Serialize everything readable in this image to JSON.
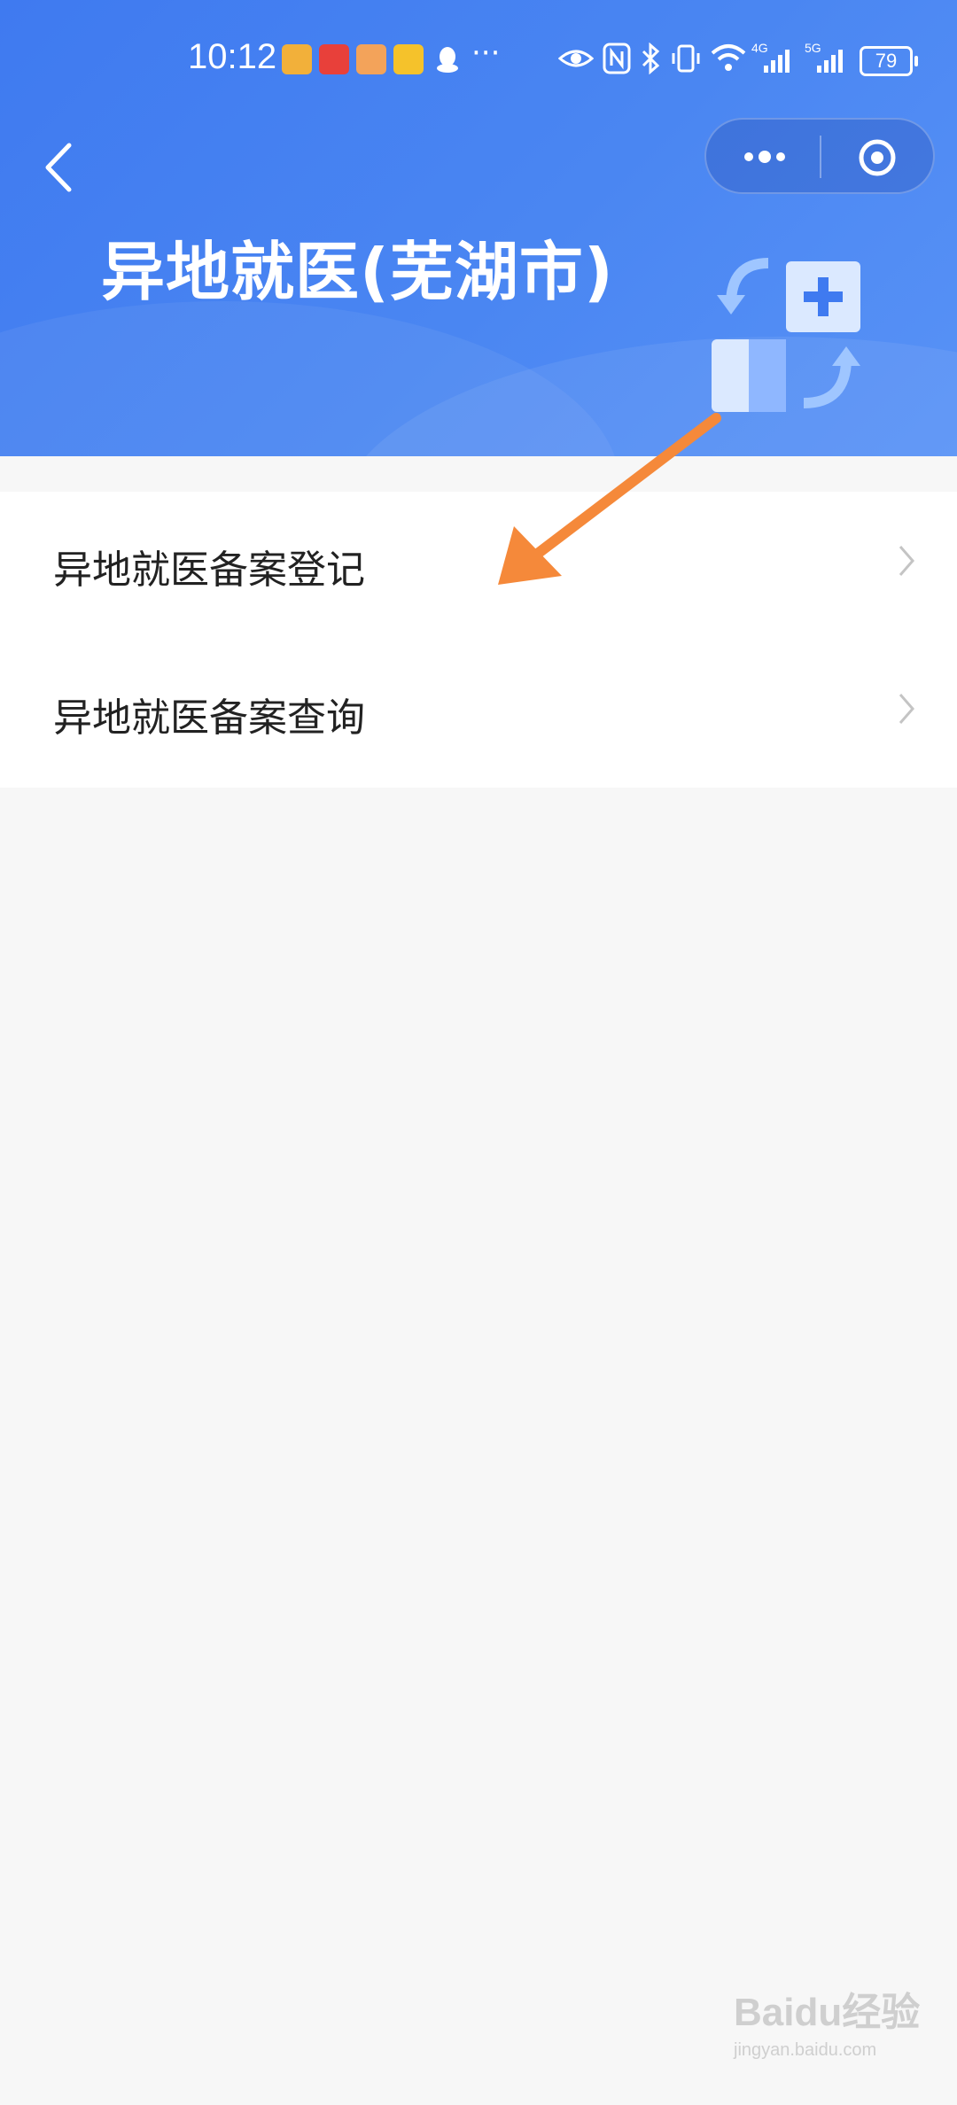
{
  "status_bar": {
    "time": "10:12",
    "more": "···",
    "network_1": "4G",
    "network_2": "5G",
    "battery": "79",
    "icons": [
      "weibo-icon",
      "app-icon",
      "app-icon",
      "mail-icon",
      "qq-icon",
      "eye-icon",
      "nfc-icon",
      "bluetooth-icon",
      "vibrate-icon",
      "wifi-icon",
      "signal-icon",
      "signal-icon"
    ]
  },
  "nav": {
    "back_icon": "chevron-left-icon",
    "more_icon": "more-dots-icon",
    "close_icon": "target-circle-icon"
  },
  "header": {
    "title": "异地就医(芜湖市)",
    "hero_icon": "transfer-medical-icon"
  },
  "menu": {
    "items": [
      {
        "label": "异地就医备案登记"
      },
      {
        "label": "异地就医备案查询"
      }
    ]
  },
  "annotation": {
    "color": "#f5893a"
  },
  "watermark": {
    "main": "Baidu经验",
    "sub": "jingyan.baidu.com"
  },
  "colors": {
    "header_blue": "#4a86f2",
    "page_bg": "#f7f7f7"
  }
}
